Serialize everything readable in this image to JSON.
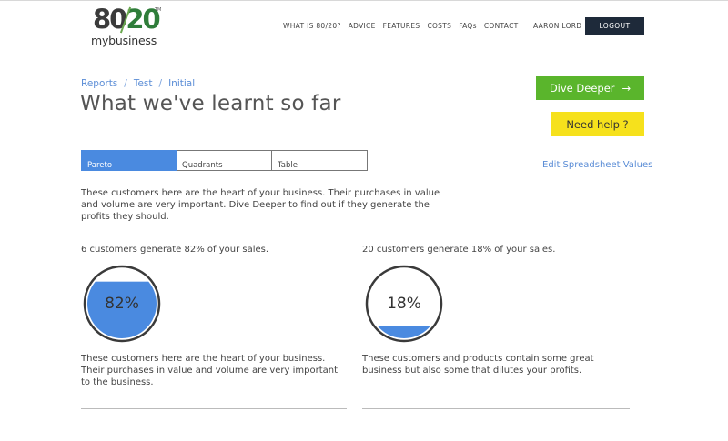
{
  "logo": {
    "number_a": "80",
    "number_b": "20",
    "trademark": "TM",
    "subtitle": "mybusiness"
  },
  "nav": {
    "items": [
      "WHAT IS 80/20?",
      "ADVICE",
      "FEATURES",
      "COSTS",
      "FAQs",
      "CONTACT"
    ]
  },
  "user": {
    "name": "AARON LORD",
    "logout_label": "LOGOUT"
  },
  "breadcrumb": {
    "items": [
      "Reports",
      "Test",
      "Initial"
    ],
    "separator": "/"
  },
  "page": {
    "title": "What we've learnt so far"
  },
  "actions": {
    "dive_label": "Dive Deeper",
    "dive_arrow": "→",
    "help_label": "Need help ?"
  },
  "tabs": [
    {
      "label": "Pareto",
      "active": true
    },
    {
      "label": "Quadrants",
      "active": false
    },
    {
      "label": "Table",
      "active": false
    }
  ],
  "edit_link": "Edit Spreadsheet Values",
  "intro": "These customers here are the heart of your business. Their purchases in value and volume are very important. Dive Deeper to find out if they generate the profits they should.",
  "panels": [
    {
      "stat": "6 customers generate 82% of your sales.",
      "percent_label": "82%",
      "fill_fraction": 0.82,
      "description": "These customers here are the heart of your business. Their purchases in value and volume are very important to the business."
    },
    {
      "stat": "20 customers generate 18% of your sales.",
      "percent_label": "18%",
      "fill_fraction": 0.18,
      "description": "These customers and products contain some great business but also some that dilutes your profits."
    }
  ],
  "colors": {
    "accent_blue": "#4a8ae0",
    "green": "#5ab52c",
    "yellow": "#f6e11c",
    "dark": "#1e2a3a"
  }
}
